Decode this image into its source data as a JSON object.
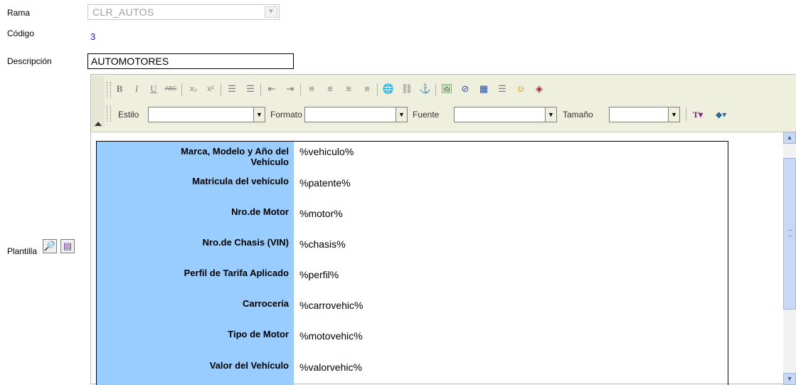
{
  "form": {
    "rama_label": "Rama",
    "rama_value": "CLR_AUTOS",
    "codigo_label": "Código",
    "codigo_value": "3",
    "descripcion_label": "Descripción",
    "descripcion_value": "AUTOMOTORES",
    "plantilla_label": "Plantilla"
  },
  "toolbar": {
    "row1_buttons": [
      {
        "name": "bold-button",
        "glyph": "B"
      },
      {
        "name": "italic-button",
        "glyph": "I"
      },
      {
        "name": "underline-button",
        "glyph": "U"
      },
      {
        "name": "strikethrough-button",
        "glyph": "ABC"
      },
      {
        "name": "subscript-button",
        "glyph": "x₂"
      },
      {
        "name": "superscript-button",
        "glyph": "x²"
      },
      {
        "name": "ordered-list-button",
        "glyph": "☰"
      },
      {
        "name": "unordered-list-button",
        "glyph": "☰"
      },
      {
        "name": "outdent-button",
        "glyph": "⇤"
      },
      {
        "name": "indent-button",
        "glyph": "⇥"
      },
      {
        "name": "align-left-button",
        "glyph": "≡"
      },
      {
        "name": "align-center-button",
        "glyph": "≡"
      },
      {
        "name": "align-right-button",
        "glyph": "≡"
      },
      {
        "name": "justify-button",
        "glyph": "≡"
      },
      {
        "name": "insert-link-button",
        "glyph": "🌐"
      },
      {
        "name": "remove-link-button",
        "glyph": "⛓"
      },
      {
        "name": "anchor-button",
        "glyph": "⚓"
      },
      {
        "name": "insert-image-button",
        "glyph": "🖼"
      },
      {
        "name": "insert-flash-button",
        "glyph": "⊘"
      },
      {
        "name": "insert-table-button",
        "glyph": "▦"
      },
      {
        "name": "horizontal-rule-button",
        "glyph": "☰"
      },
      {
        "name": "smiley-button",
        "glyph": "☺"
      },
      {
        "name": "special-char-button",
        "glyph": "◈"
      }
    ],
    "estilo_label": "Estilo",
    "formato_label": "Formato",
    "fuente_label": "Fuente",
    "tamano_label": "Tamaño",
    "text_color_glyph": "T",
    "bg_color_glyph": "◆"
  },
  "template_rows": [
    {
      "label_line1": "Marca, Modelo y Año del",
      "label_line2": "Vehículo",
      "value": "%vehiculo%"
    },
    {
      "label_line1": "Matricula del vehículo",
      "label_line2": "",
      "value": "%patente%"
    },
    {
      "label_line1": "Nro.de Motor",
      "label_line2": "",
      "value": "%motor%"
    },
    {
      "label_line1": "Nro.de Chasis (VIN)",
      "label_line2": "",
      "value": "%chasis%"
    },
    {
      "label_line1": "Perfil de Tarifa Aplicado",
      "label_line2": "",
      "value": "%perfil%"
    },
    {
      "label_line1": "Carrocería",
      "label_line2": "",
      "value": "%carrovehic%"
    },
    {
      "label_line1": "Tipo de Motor",
      "label_line2": "",
      "value": "%motovehic%"
    },
    {
      "label_line1": "Valor del Vehículo",
      "label_line2": "",
      "value": "%valorvehic%"
    }
  ],
  "colors": {
    "label_column": "#99ccff",
    "toolbar_bg": "#efefde",
    "scrollbar": "#c9d9f5",
    "codigo_text": "#1a1aa6"
  }
}
